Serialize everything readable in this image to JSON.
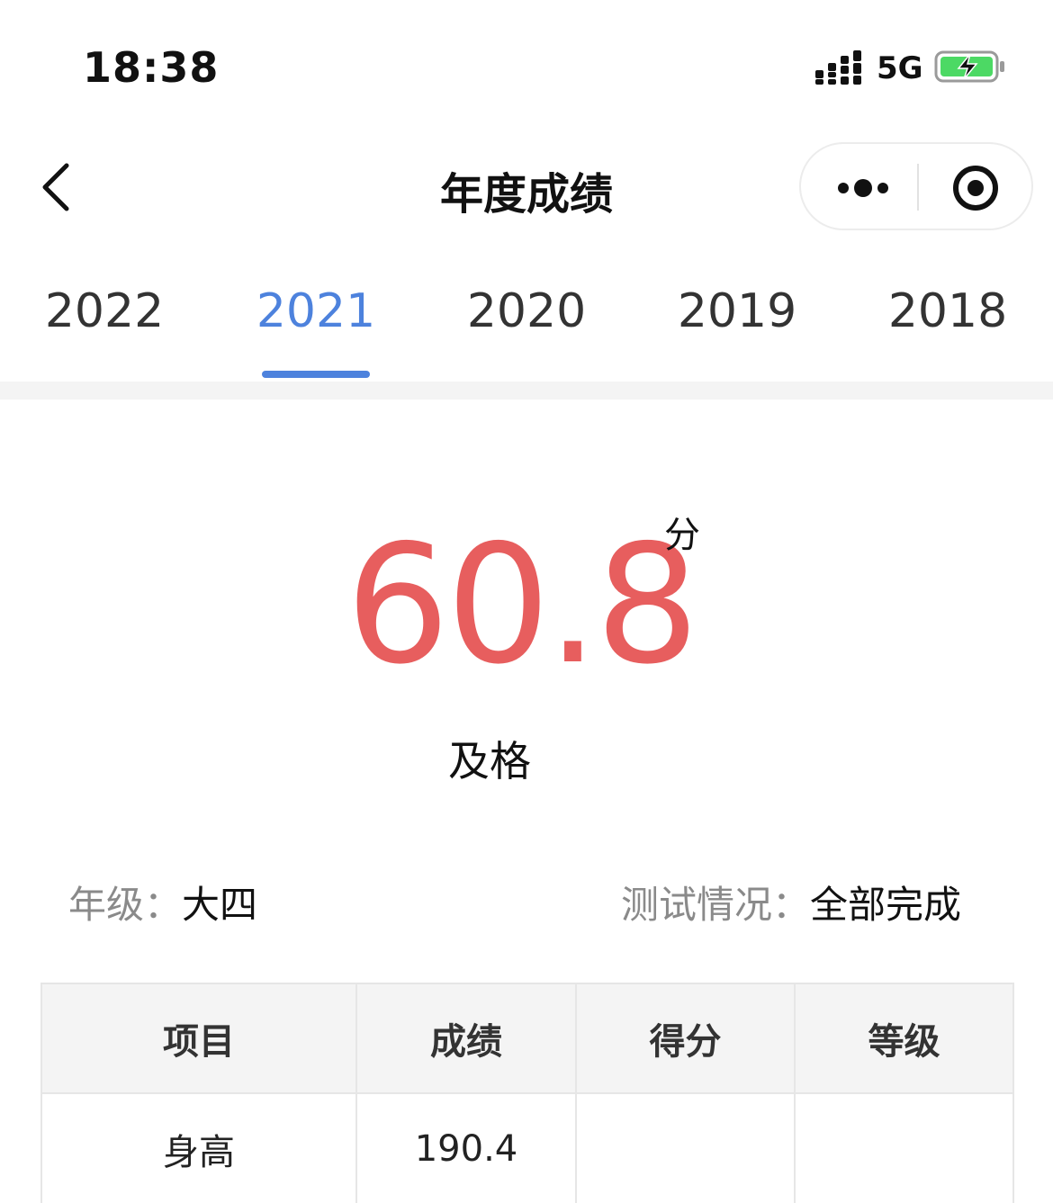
{
  "status_bar": {
    "time": "18:38",
    "network": "5G",
    "icons": [
      "signal-icon",
      "battery-charging-icon"
    ],
    "battery_color": "#4cd964"
  },
  "nav": {
    "title": "年度成绩",
    "back_icon": "back-chevron-icon",
    "more_icon": "more-dots-icon",
    "close_icon": "target-close-icon"
  },
  "year_tabs": {
    "items": [
      "2022",
      "2021",
      "2020",
      "2019",
      "2018"
    ],
    "selected": "2021",
    "active_color": "#4d82dd"
  },
  "score": {
    "value": "60.8",
    "unit": "分",
    "level": "及格",
    "color": "#e75e5e"
  },
  "info": {
    "grade_label": "年级：",
    "grade_value": "大四",
    "test_label": "测试情况：",
    "test_value": "全部完成"
  },
  "table": {
    "headers": [
      "项目",
      "成绩",
      "得分",
      "等级"
    ],
    "rows": [
      [
        "身高",
        "190.4",
        "",
        ""
      ]
    ]
  }
}
